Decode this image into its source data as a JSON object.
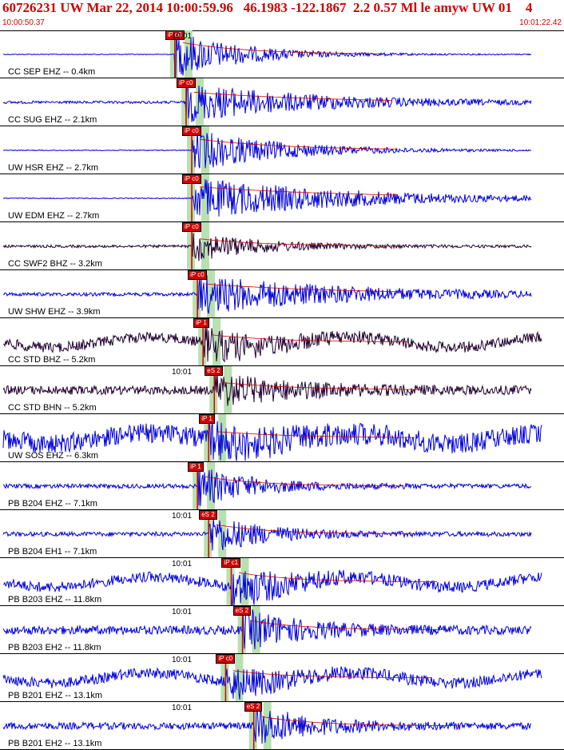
{
  "header": {
    "title": "60726231 UW Mar 22, 2014 10:00:59.96   46.1983 -122.1867  2.2 0.57 Ml le amyw UW 01    4",
    "start_time": "10:00:50.37",
    "end_time": "10:01:22.42"
  },
  "colors": {
    "trace_blue": "#0000e0",
    "trace_dark": "#200030",
    "pick_red": "#d00000",
    "shading_green": "#b8e0b0",
    "coda_red": "#cc0000"
  },
  "panels": [
    {
      "label": "CC SEP EHZ -- 0.4km",
      "time_label": "10:01",
      "pick": "iP c0",
      "color": "blue",
      "onset": 0.31,
      "amp": 0.55,
      "decay": 0.12,
      "noise": 0.01
    },
    {
      "label": "CC SUG EHZ -- 2.1km",
      "time_label": "",
      "pick": "iP c0",
      "color": "blue",
      "onset": 0.33,
      "amp": 0.45,
      "decay": 0.22,
      "noise": 0.03
    },
    {
      "label": "UW HSR EHZ -- 2.7km",
      "time_label": "",
      "pick": "iP c0",
      "color": "blue",
      "onset": 0.34,
      "amp": 0.5,
      "decay": 0.16,
      "noise": 0.01
    },
    {
      "label": "UW EDM EHZ -- 2.7km",
      "time_label": "",
      "pick": "iP c0",
      "color": "blue",
      "onset": 0.34,
      "amp": 0.5,
      "decay": 0.28,
      "noise": 0.01
    },
    {
      "label": "CC SWF2 BHZ -- 3.2km",
      "time_label": "",
      "pick": "iP c0",
      "color": "dark",
      "onset": 0.34,
      "amp": 0.35,
      "decay": 0.12,
      "noise": 0.03
    },
    {
      "label": "UW SHW EHZ -- 3.9km",
      "time_label": "",
      "pick": "iP c0",
      "color": "blue",
      "onset": 0.35,
      "amp": 0.45,
      "decay": 0.25,
      "noise": 0.04
    },
    {
      "label": "CC STD BHZ -- 5.2km",
      "time_label": "",
      "pick": "iP 1",
      "color": "dark",
      "onset": 0.36,
      "amp": 0.35,
      "decay": 0.12,
      "noise": 0.12
    },
    {
      "label": "CC STD BHN -- 5.2km",
      "time_label": "10:01",
      "pick": "eS 2",
      "color": "dark",
      "onset": 0.38,
      "amp": 0.35,
      "decay": 0.14,
      "noise": 0.1
    },
    {
      "label": "UW SOS EHZ -- 6.3km",
      "time_label": "",
      "pick": "iP 1",
      "color": "blue",
      "onset": 0.37,
      "amp": 0.3,
      "decay": 0.15,
      "noise": 0.22
    },
    {
      "label": "PB B204 EHZ -- 7.1km",
      "time_label": "",
      "pick": "iP 1",
      "color": "blue",
      "onset": 0.35,
      "amp": 0.45,
      "decay": 0.1,
      "noise": 0.05
    },
    {
      "label": "PB B204 EH1 -- 7.1km",
      "time_label": "10:01",
      "pick": "eS 2",
      "color": "blue",
      "onset": 0.37,
      "amp": 0.45,
      "decay": 0.1,
      "noise": 0.05
    },
    {
      "label": "PB B203 EHZ -- 11.8km",
      "time_label": "10:01",
      "pick": "iP c1",
      "color": "blue",
      "onset": 0.41,
      "amp": 0.45,
      "decay": 0.1,
      "noise": 0.12
    },
    {
      "label": "PB B203 EH2 -- 11.8km",
      "time_label": "10:01",
      "pick": "eS 2",
      "color": "blue",
      "onset": 0.43,
      "amp": 0.45,
      "decay": 0.1,
      "noise": 0.1
    },
    {
      "label": "PB B201 EHZ -- 13.1km",
      "time_label": "10:01",
      "pick": "iP c0",
      "color": "blue",
      "onset": 0.4,
      "amp": 0.35,
      "decay": 0.1,
      "noise": 0.12
    },
    {
      "label": "PB B201 EH2 -- 13.1km",
      "time_label": "10:01",
      "pick": "eS 2",
      "color": "blue",
      "onset": 0.45,
      "amp": 0.45,
      "decay": 0.1,
      "noise": 0.08
    }
  ]
}
